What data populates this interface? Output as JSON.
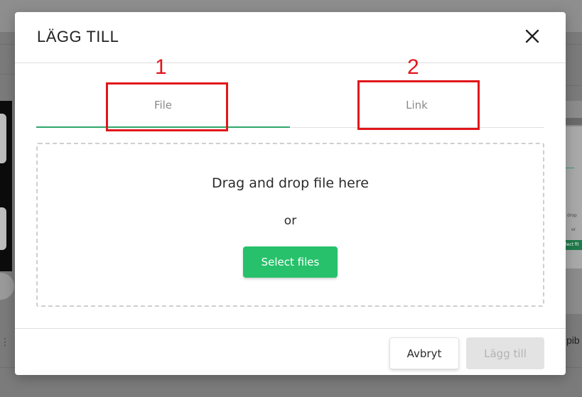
{
  "modal": {
    "title": "LÄGG TILL",
    "close_icon": "close-icon"
  },
  "tabs": [
    {
      "label": "File",
      "active": true
    },
    {
      "label": "Link",
      "active": false
    }
  ],
  "annotations": [
    {
      "number": "1"
    },
    {
      "number": "2"
    }
  ],
  "dropzone": {
    "text": "Drag and drop file here",
    "or": "or",
    "button_label": "Select files"
  },
  "footer": {
    "cancel_label": "Avbryt",
    "add_label": "Lägg till"
  },
  "background": {
    "right_panel": {
      "drop_text": "drop",
      "or_text": "or",
      "btn_text": "lect fil"
    },
    "right_text": "pib",
    "left_text": "⋮"
  },
  "colors": {
    "accent": "#27c16b",
    "tab_underline": "#2ea86a",
    "annotation": "#e1161b",
    "disabled_bg": "#e3e3e3"
  }
}
